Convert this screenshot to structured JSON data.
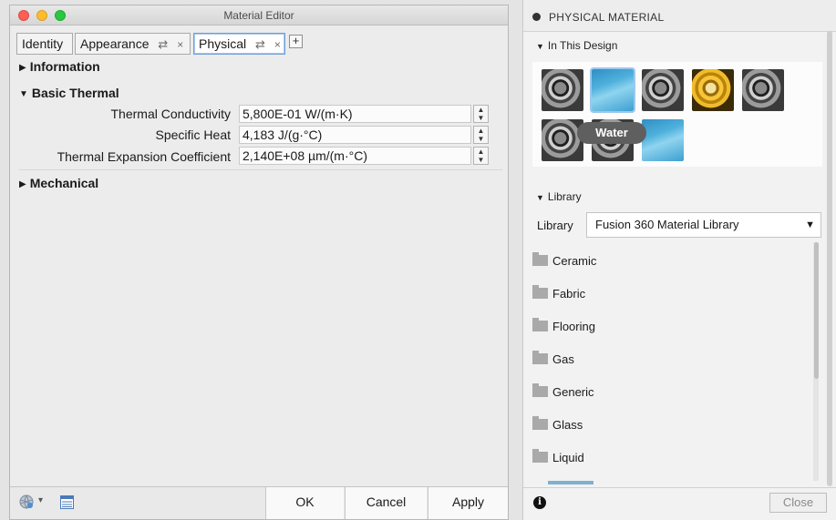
{
  "editor": {
    "title": "Material Editor",
    "tabs": [
      {
        "label": "Identity"
      },
      {
        "label": "Appearance",
        "swap_icon": "⇄",
        "close": "×"
      },
      {
        "label": "Physical",
        "swap_icon": "⇄",
        "close": "×"
      }
    ],
    "add_tab": "+",
    "sections": {
      "information": "Information",
      "basic_thermal": "Basic Thermal",
      "mechanical": "Mechanical"
    },
    "properties": [
      {
        "label": "Thermal Conductivity",
        "value": "5,800E-01 W/(m·K)"
      },
      {
        "label": "Specific Heat",
        "value": "4,183 J/(g·°C)"
      },
      {
        "label": "Thermal Expansion Coefficient",
        "value": "2,140E+08 µm/(m·°C)"
      }
    ],
    "buttons": {
      "ok": "OK",
      "cancel": "Cancel",
      "apply": "Apply"
    },
    "bottom_caret": "▾"
  },
  "panel": {
    "title": "PHYSICAL MATERIAL",
    "in_this_design": "In This Design",
    "swatches": [
      "metal",
      "water",
      "metal",
      "gold",
      "metal",
      "metal",
      "metal",
      "water"
    ],
    "tooltip": "Water",
    "library_section": "Library",
    "library_label": "Library",
    "library_value": "Fusion 360 Material Library",
    "folders": [
      "Ceramic",
      "Fabric",
      "Flooring",
      "Gas",
      "Generic",
      "Glass",
      "Liquid"
    ],
    "close_label": "Close",
    "info_glyph": "i"
  },
  "colors": {
    "close_light": "#fc5f57",
    "minimize_light": "#fdbb2e",
    "maximize_light": "#28c840",
    "active_tab_border": "#6f9fd8",
    "tooltip_bg": "#5f5f5f"
  }
}
